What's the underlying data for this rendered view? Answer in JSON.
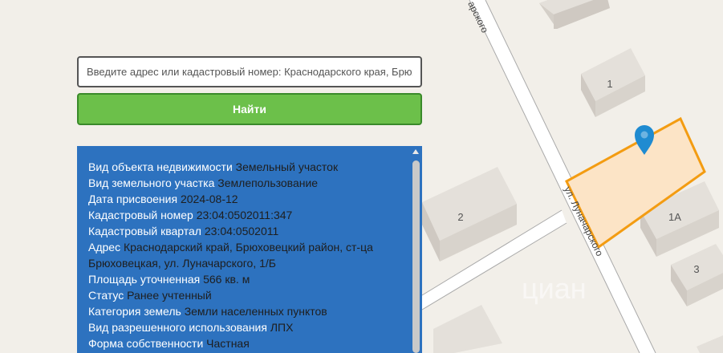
{
  "search": {
    "placeholder": "Введите адрес или кадастровый номер: Краснодарского края, Брюховецкого района",
    "button_label": "Найти"
  },
  "map": {
    "street_label": "ул. Луначарского",
    "street_label_top": "арского",
    "building_numbers": [
      "1",
      "2",
      "1А",
      "3"
    ],
    "watermark": "циан",
    "colors": {
      "background": "#f2efe9",
      "building": "#e4e0da",
      "road": "#ffffff",
      "road_edge": "#a9a9a9",
      "parcel_fill": "#fce4c6",
      "parcel_stroke": "#f39c12",
      "marker": "#1f8bd1"
    }
  },
  "info": {
    "rows": [
      {
        "label": "Вид объекта недвижимости",
        "value": "Земельный участок"
      },
      {
        "label": "Вид земельного участка",
        "value": "Землепользование"
      },
      {
        "label": "Дата присвоения",
        "value": "2024-08-12"
      },
      {
        "label": "Кадастровый номер",
        "value": "23:04:0502011:347"
      },
      {
        "label": "Кадастровый квартал",
        "value": "23:04:0502011"
      },
      {
        "label": "Адрес",
        "value": "Краснодарский край, Брюховецкий район, ст-ца Брюховецкая, ул. Луначарского, 1/Б"
      },
      {
        "label": "Площадь уточненная",
        "value": "566 кв. м"
      },
      {
        "label": "Статус",
        "value": "Ранее учтенный"
      },
      {
        "label": "Категория земель",
        "value": "Земли населенных пунктов"
      },
      {
        "label": "Вид разрешенного использования",
        "value": "ЛПХ"
      },
      {
        "label": "Форма собственности",
        "value": "Частная"
      }
    ],
    "colors": {
      "panel": "#2d72bf",
      "label": "#ffffff",
      "value": "#1e1e1e"
    }
  }
}
